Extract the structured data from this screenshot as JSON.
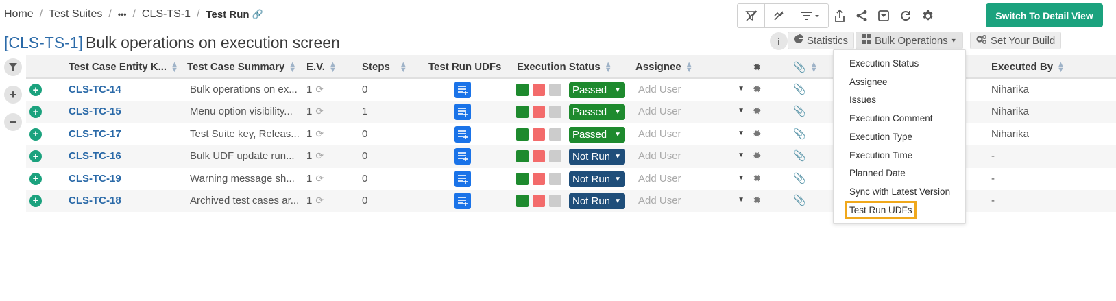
{
  "breadcrumb": {
    "items": [
      "Home",
      "Test Suites",
      "•••",
      "CLS-TS-1"
    ],
    "current": "Test Run",
    "separator": "/"
  },
  "title": {
    "key": "[CLS-TS-1]",
    "name": "Bulk operations on execution screen"
  },
  "toolbar": {
    "switch_label": "Switch To Detail View",
    "statistics_label": "Statistics",
    "bulk_label": "Bulk Operations",
    "build_label": "Set Your Build",
    "info_label": "i"
  },
  "table": {
    "headers": {
      "key": "Test Case Entity K...",
      "summary": "Test Case Summary",
      "ev": "E.V.",
      "steps": "Steps",
      "udfs": "Test Run UDFs",
      "status": "Execution Status",
      "assignee": "Assignee",
      "executed_by": "Executed By"
    },
    "rows": [
      {
        "key": "CLS-TC-14",
        "summary": "Bulk operations on ex...",
        "ev": "1",
        "steps": "0",
        "status": "Passed",
        "assignee": "Add User",
        "executed_by": "Niharika"
      },
      {
        "key": "CLS-TC-15",
        "summary": "Menu option visibility...",
        "ev": "1",
        "steps": "1",
        "status": "Passed",
        "assignee": "Add User",
        "executed_by": "Niharika"
      },
      {
        "key": "CLS-TC-17",
        "summary": "Test Suite key, Releas...",
        "ev": "1",
        "steps": "0",
        "status": "Passed",
        "assignee": "Add User",
        "executed_by": "Niharika"
      },
      {
        "key": "CLS-TC-16",
        "summary": "Bulk UDF update run...",
        "ev": "1",
        "steps": "0",
        "status": "Not Run",
        "assignee": "Add User",
        "executed_by": "-"
      },
      {
        "key": "CLS-TC-19",
        "summary": "Warning message sh...",
        "ev": "1",
        "steps": "0",
        "status": "Not Run",
        "assignee": "Add User",
        "executed_by": "-"
      },
      {
        "key": "CLS-TC-18",
        "summary": "Archived test cases ar...",
        "ev": "1",
        "steps": "0",
        "status": "Not Run",
        "assignee": "Add User",
        "executed_by": "-"
      }
    ]
  },
  "menu": {
    "items": [
      "Execution Status",
      "Assignee",
      "Issues",
      "Execution Comment",
      "Execution Type",
      "Execution Time",
      "Planned Date",
      "Sync with Latest Version",
      "Test Run UDFs"
    ],
    "highlighted": "Test Run UDFs"
  },
  "colors": {
    "accent": "#1ba27e",
    "link": "#2b6aa8",
    "passed": "#1e8a2e",
    "not_run": "#1f4e7a",
    "highlight": "#f0a81c"
  }
}
